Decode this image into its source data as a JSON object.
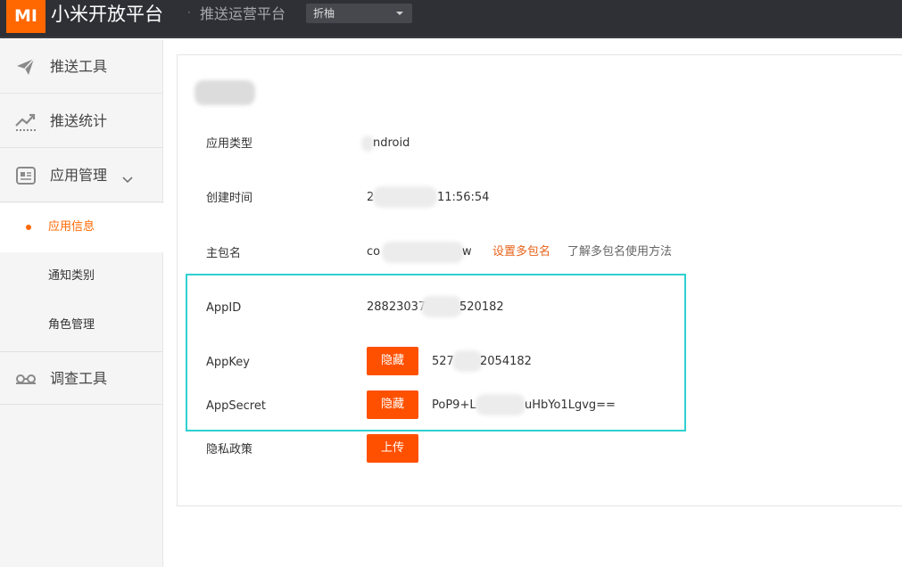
{
  "header": {
    "logo_text": "MI",
    "brand": "小米开放平台",
    "separator": "·",
    "subbrand": "推送运营平台",
    "collapse_select": "折柚"
  },
  "sidebar": {
    "items": [
      {
        "label": "推送工具",
        "icon": "paper-plane-icon"
      },
      {
        "label": "推送统计",
        "icon": "trend-chart-icon"
      },
      {
        "label": "应用管理",
        "icon": "app-card-icon",
        "expanded": true
      },
      {
        "label": "调查工具",
        "icon": "glasses-icon"
      }
    ],
    "subitems": [
      {
        "label": "应用信息",
        "active": true
      },
      {
        "label": "通知类别"
      },
      {
        "label": "角色管理"
      }
    ]
  },
  "main": {
    "rows": {
      "app_type": {
        "label": "应用类型",
        "value": "ndroid"
      },
      "created": {
        "label": "创建时间",
        "value_prefix": "2",
        "value_suffix": "11:56:54"
      },
      "package": {
        "label": "主包名",
        "value_prefix": "co",
        "value_suffix": "w",
        "set_multi": "设置多包名",
        "learn_more": "了解多包名使用方法"
      },
      "appid": {
        "label": "AppID",
        "value_prefix": "28823037",
        "value_suffix": "520182"
      },
      "appkey": {
        "label": "AppKey",
        "button": "隐藏",
        "value_prefix": "527",
        "value_suffix": "2054182"
      },
      "appsecret": {
        "label": "AppSecret",
        "button": "隐藏",
        "value_prefix": "PoP9+L",
        "value_suffix": "uHbYo1Lgvg=="
      },
      "privacy": {
        "label": "隐私政策",
        "button": "上传"
      }
    }
  },
  "colors": {
    "accent": "#ff6700",
    "button": "#ff5000",
    "highlight": "#2fd0d0",
    "topbar": "#2e3035"
  }
}
